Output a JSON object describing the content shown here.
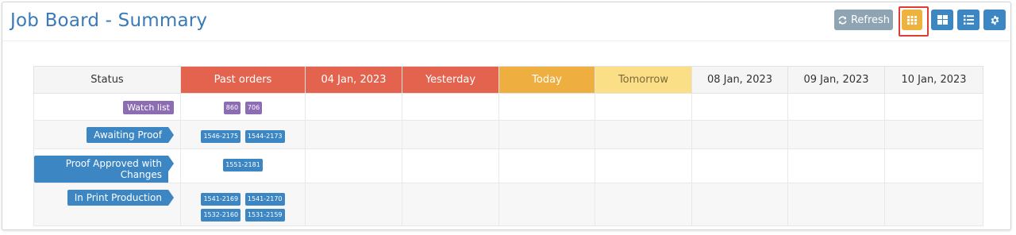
{
  "page": {
    "title": "Job Board - Summary"
  },
  "toolbar": {
    "refresh_label": "Refresh",
    "colors": {
      "refresh": "#8fa4b3",
      "active": "#eeb23f",
      "blue": "#3c86c4"
    }
  },
  "table": {
    "headers": {
      "status": "Status",
      "past": "Past orders",
      "jan04": "04 Jan, 2023",
      "yesterday": "Yesterday",
      "today": "Today",
      "tomorrow": "Tomorrow",
      "jan08": "08 Jan, 2023",
      "jan09": "09 Jan, 2023",
      "jan10": "10 Jan, 2023"
    },
    "rows": [
      {
        "status": "Watch list",
        "orders": [
          "860",
          "706"
        ]
      },
      {
        "status": "Awaiting Proof",
        "orders": [
          "1546-2175",
          "1544-2173"
        ]
      },
      {
        "status": "Proof Approved with Changes",
        "orders": [
          "1551-2181"
        ]
      },
      {
        "status": "In Print Production",
        "orders": [
          "1541-2169",
          "1541-2170",
          "1532-2160",
          "1531-2159"
        ]
      }
    ]
  }
}
